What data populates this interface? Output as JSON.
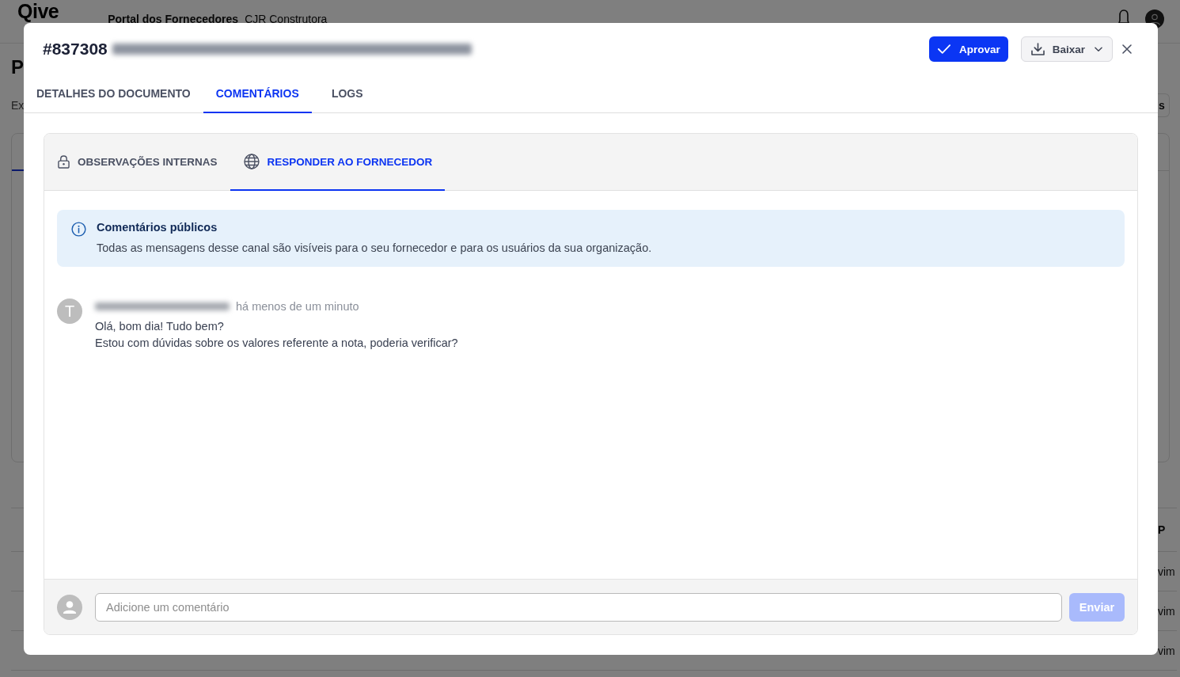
{
  "background_page": {
    "logo": "Qive",
    "portal_title": "Portal dos Fornecedores",
    "company": "CJR Construtora",
    "page_title": "P",
    "subtitle": "Ex",
    "action_button": "s",
    "table_header": "P",
    "table_cells": [
      "vim",
      "vim",
      "vim"
    ]
  },
  "dialog": {
    "number": "#837308",
    "name_redacted": true,
    "actions": [
      {
        "kind": "primary",
        "label": "Aprovar"
      },
      {
        "kind": "menu",
        "label": "Baixar"
      }
    ],
    "tabs": [
      {
        "label": "DETALHES DO DOCUMENTO",
        "selected": false
      },
      {
        "label": "COMENTÁRIOS",
        "selected": true
      },
      {
        "label": "LOGS",
        "selected": false
      }
    ],
    "comment_channels": [
      {
        "kind": "internal",
        "label": "OBSERVAÇÕES INTERNAS",
        "selected": false
      },
      {
        "kind": "public",
        "label": "RESPONDER AO FORNECEDOR",
        "selected": true
      }
    ],
    "notice": {
      "title": "Comentários públicos",
      "text": "Todas as mensagens desse canal são visíveis para o seu fornecedor e para os usuários da sua organização."
    },
    "comments": [
      {
        "avatar_letter": "T",
        "author_redacted": true,
        "time": "há menos de um minuto",
        "lines": [
          "Olá, bom dia! Tudo bem?",
          "Estou com dúvidas sobre os valores referente a nota, poderia verificar?"
        ]
      }
    ],
    "composer": {
      "placeholder": "Adicione um comentário",
      "send_label": "Enviar",
      "send_disabled": true
    }
  }
}
